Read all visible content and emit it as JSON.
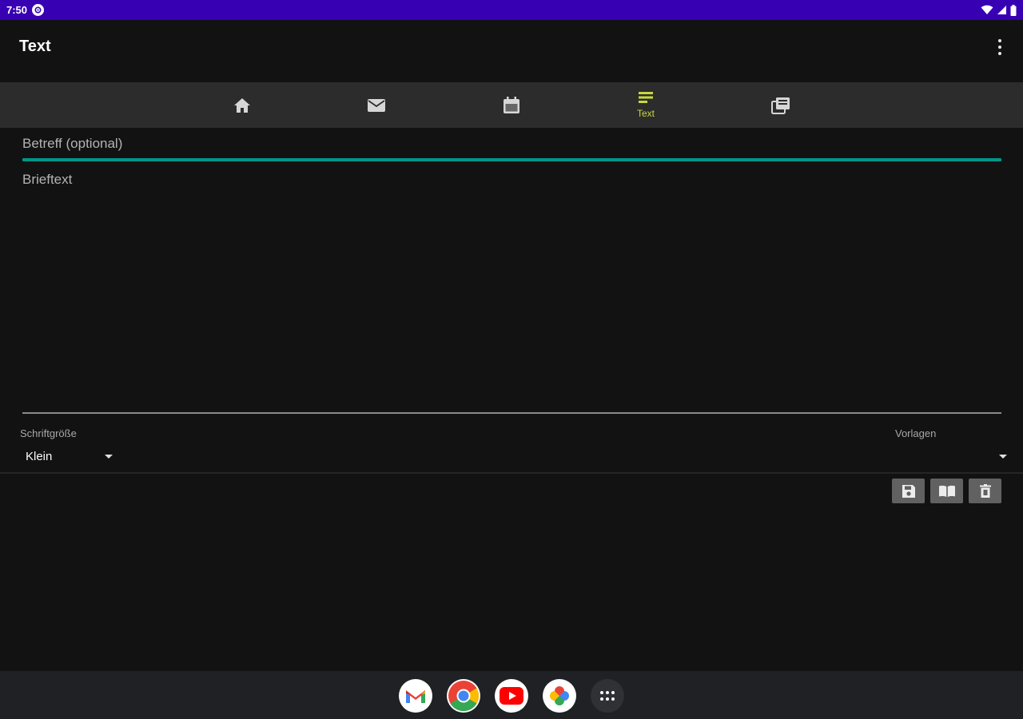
{
  "status_bar": {
    "time": "7:50",
    "icons": [
      "notification-icon",
      "wifi-icon",
      "signal-icon",
      "battery-icon"
    ]
  },
  "app_bar": {
    "title": "Text",
    "menu_icon": "overflow-menu-icon"
  },
  "tabs": [
    {
      "icon": "home-icon",
      "label": "",
      "selected": false
    },
    {
      "icon": "mail-icon",
      "label": "",
      "selected": false
    },
    {
      "icon": "calendar-icon",
      "label": "",
      "selected": false
    },
    {
      "icon": "text-icon",
      "label": "Text",
      "selected": true
    },
    {
      "icon": "templates-icon",
      "label": "",
      "selected": false
    }
  ],
  "form": {
    "subject_placeholder": "Betreff (optional)",
    "body_placeholder": "Brieftext",
    "font_size_label": "Schriftgröße",
    "font_size_value": "Klein",
    "templates_label": "Vorlagen",
    "templates_value": ""
  },
  "actions": [
    {
      "icon": "save-icon"
    },
    {
      "icon": "book-icon"
    },
    {
      "icon": "delete-icon"
    }
  ],
  "dock": {
    "apps": [
      "gmail-icon",
      "chrome-icon",
      "youtube-icon",
      "photos-icon",
      "app-drawer-icon"
    ]
  },
  "colors": {
    "status_bar": "#3700b3",
    "accent": "#009688",
    "selected_tab": "#c6d83d",
    "background": "#121212"
  }
}
